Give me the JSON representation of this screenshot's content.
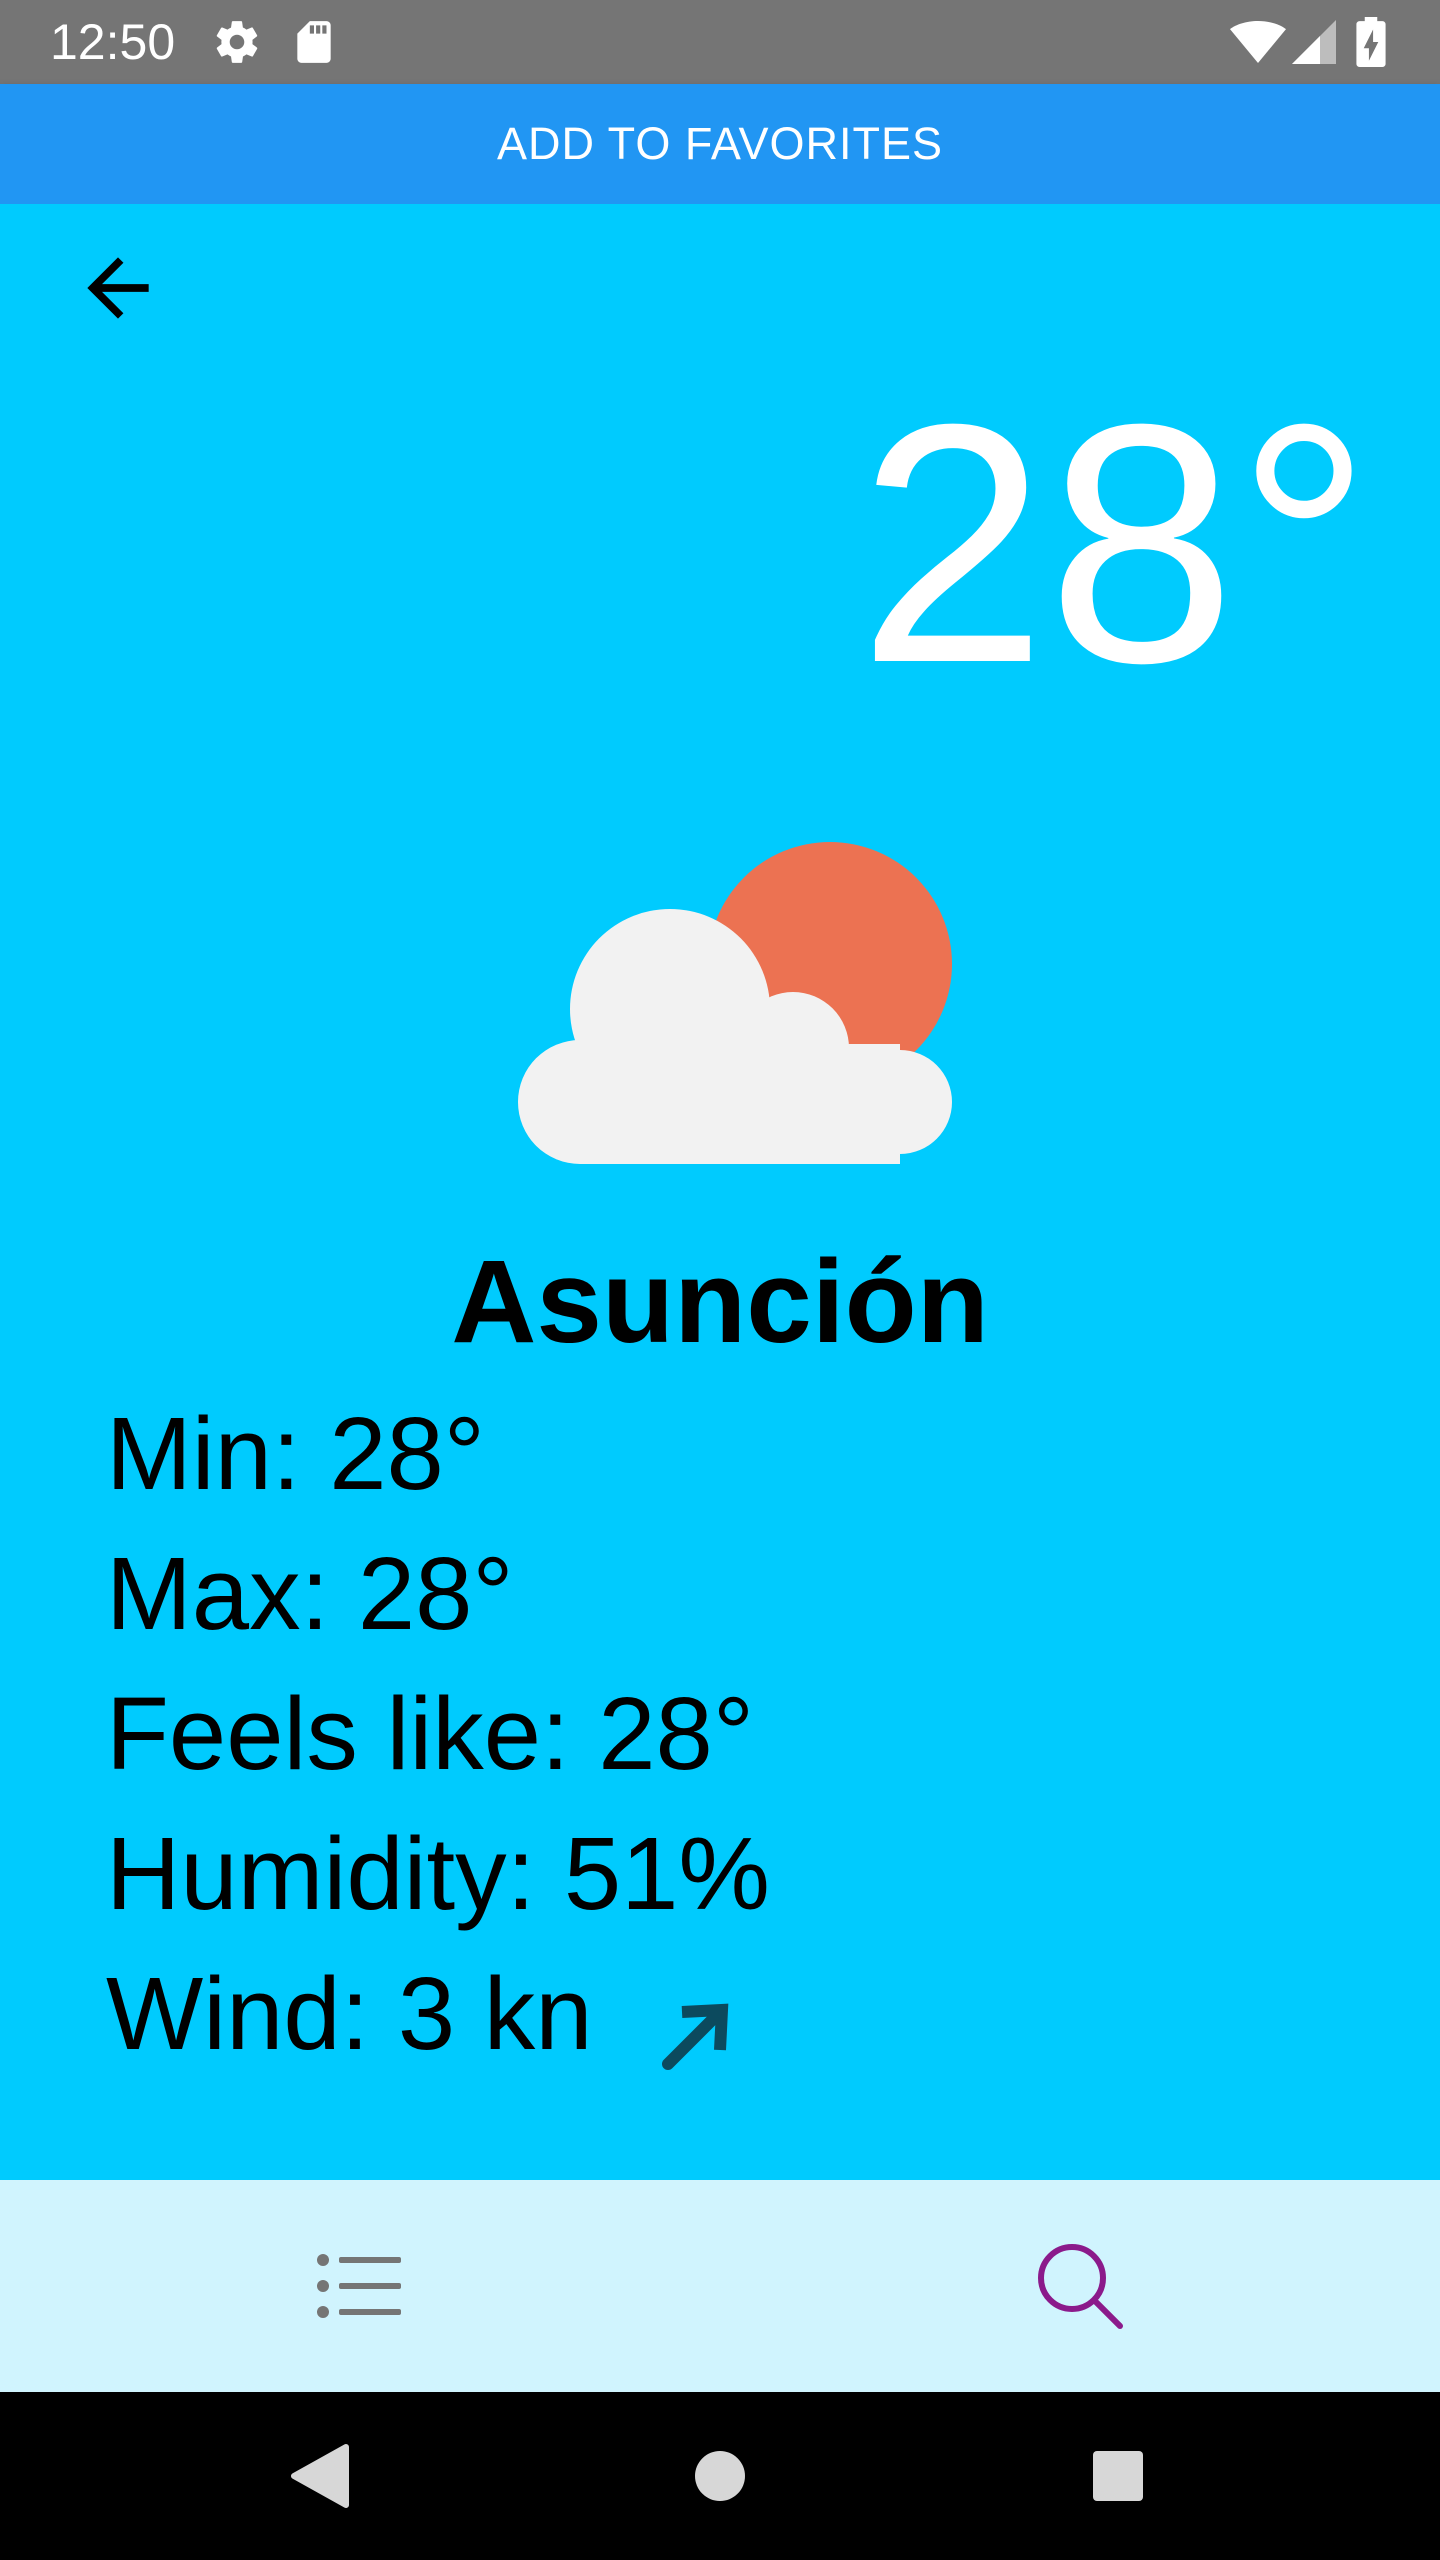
{
  "status_bar": {
    "time": "12:50",
    "icons": [
      "settings-icon",
      "sd-card-icon",
      "wifi-icon",
      "cell-signal-icon",
      "battery-charging-icon"
    ]
  },
  "action": {
    "label": "ADD TO FAVORITES"
  },
  "weather": {
    "temperature": "28°",
    "icon": "partly-cloudy-icon",
    "city": "Asunción",
    "details": {
      "min": "Min: 28°",
      "max": "Max: 28°",
      "feels_like": "Feels like: 28°",
      "humidity": "Humidity: 51%",
      "wind": "Wind: 3 kn"
    }
  },
  "bottom_nav": {
    "items": [
      {
        "icon": "list-icon"
      },
      {
        "icon": "search-icon",
        "active": true
      }
    ]
  },
  "colors": {
    "background": "#00cbfe",
    "action_bar": "#2196f3",
    "bottom_nav": "#d0f4fe",
    "active_nav": "#8b1a8b",
    "sun": "#ec7252",
    "cloud": "#f2f2f2"
  }
}
